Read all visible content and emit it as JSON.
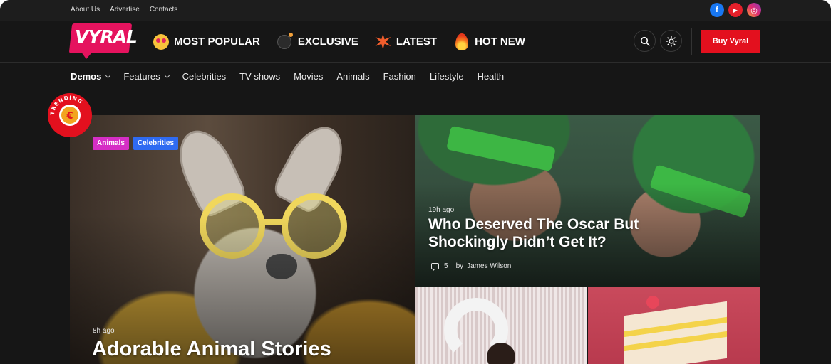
{
  "topbar": {
    "links": [
      "About Us",
      "Advertise",
      "Contacts"
    ],
    "socials": [
      {
        "name": "facebook-icon",
        "glyph": "f"
      },
      {
        "name": "youtube-icon",
        "glyph": "▶"
      },
      {
        "name": "instagram-icon",
        "glyph": "◎"
      }
    ]
  },
  "header": {
    "logo_text": "VYRAL",
    "nav": [
      {
        "label": "MOST POPULAR",
        "icon": "heart-eyes-emoji-icon"
      },
      {
        "label": "EXCLUSIVE",
        "icon": "bomb-emoji-icon"
      },
      {
        "label": "LATEST",
        "icon": "explosion-emoji-icon"
      },
      {
        "label": "HOT NEW",
        "icon": "fire-emoji-icon"
      }
    ],
    "buy_label": "Buy Vyral"
  },
  "subnav": [
    {
      "label": "Demos",
      "dropdown": true
    },
    {
      "label": "Features",
      "dropdown": true
    },
    {
      "label": "Celebrities"
    },
    {
      "label": "TV-shows"
    },
    {
      "label": "Movies"
    },
    {
      "label": "Animals"
    },
    {
      "label": "Fashion"
    },
    {
      "label": "Lifestyle"
    },
    {
      "label": "Health"
    }
  ],
  "badge": {
    "text": "TRENDING",
    "colors": {
      "ring": "#e3101e"
    }
  },
  "posts": {
    "big": {
      "tags": [
        "Animals",
        "Celebrities"
      ],
      "time": "8h ago",
      "title": "Adorable Animal Stories"
    },
    "top_right": {
      "time": "19h ago",
      "title_line1": "Who Deserved The Oscar But",
      "title_line2": "Shockingly Didn’t Get It?",
      "comments": "5",
      "by": "by",
      "author": "James Wilson"
    }
  },
  "colors": {
    "accent": "#e3101e",
    "logo": "#e5135e",
    "tag_animals": "#d62ec5",
    "tag_celebrities": "#2f6bf2",
    "background": "#161616"
  }
}
